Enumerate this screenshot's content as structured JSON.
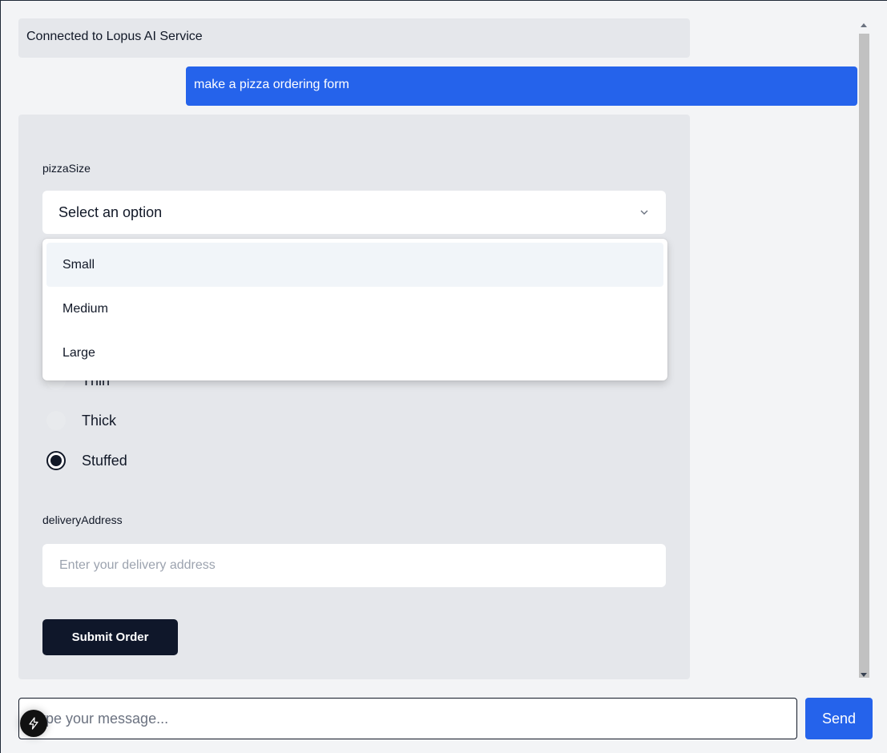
{
  "messages": {
    "system": "Connected to Lopus AI Service",
    "user": "make a pizza ordering form"
  },
  "form": {
    "pizza_size_label": "pizzaSize",
    "select_placeholder": "Select an option",
    "options": [
      "Small",
      "Medium",
      "Large"
    ],
    "crust_options": [
      "Thin",
      "Thick",
      "Stuffed"
    ],
    "crust_selected": "Stuffed",
    "delivery_label": "deliveryAddress",
    "delivery_placeholder": "Enter your delivery address",
    "submit_label": "Submit Order"
  },
  "composer": {
    "placeholder": "Type your message...",
    "send_label": "Send"
  },
  "colors": {
    "accent": "#2563eb",
    "dark": "#0f172a",
    "bubble_bg": "#e5e7eb"
  },
  "icons": {
    "select": "chevron-down-icon",
    "badge": "bolt-icon"
  }
}
